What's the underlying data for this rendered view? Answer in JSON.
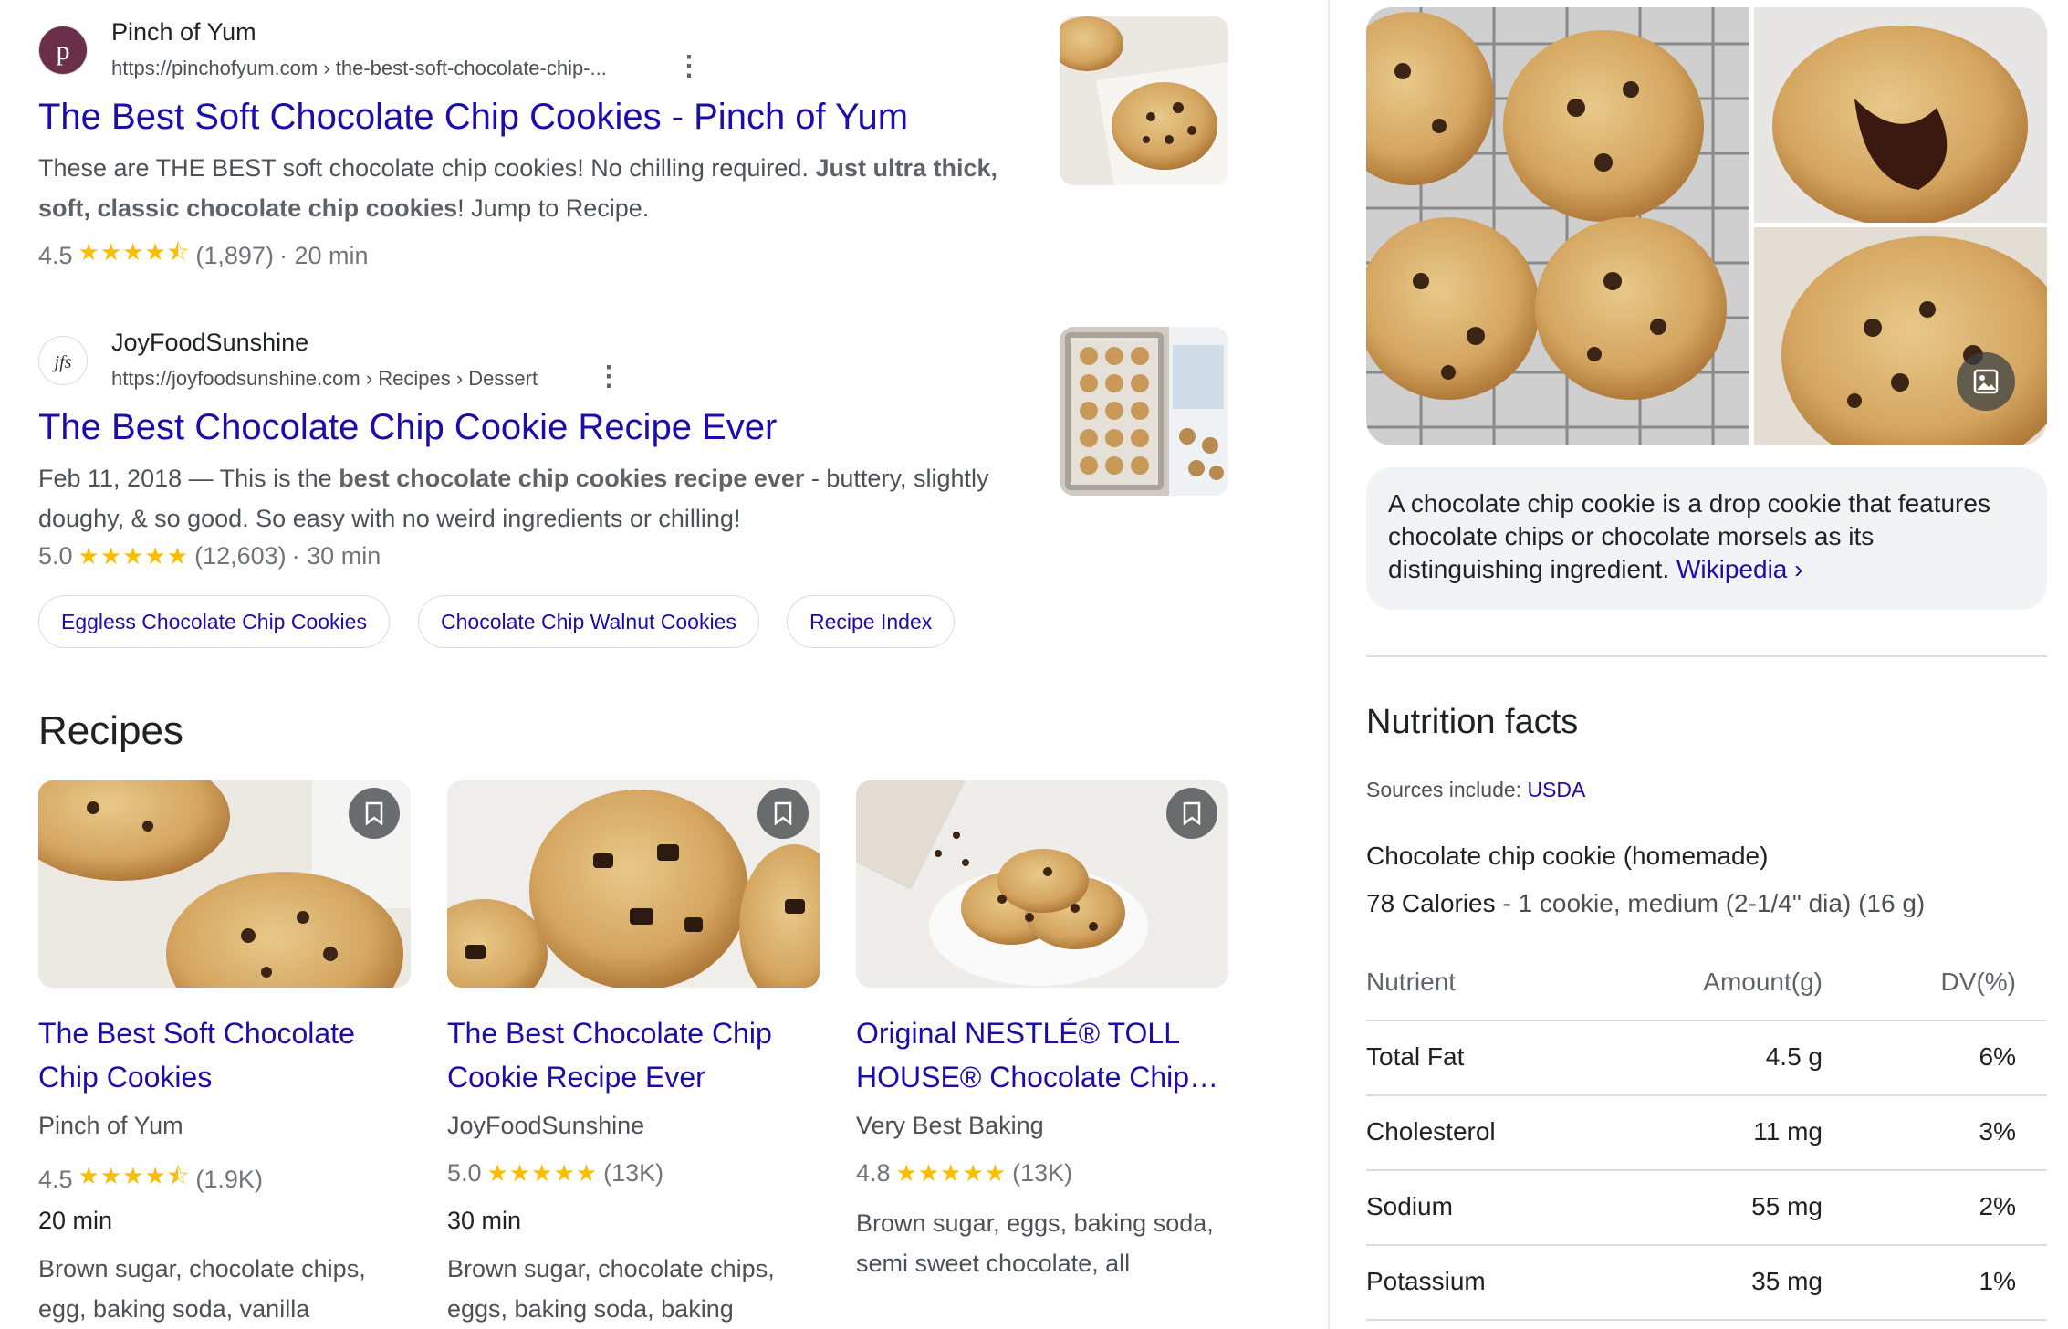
{
  "results": [
    {
      "site_name": "Pinch of Yum",
      "url": "https://pinchofyum.com › the-best-soft-chocolate-chip-...",
      "title": "The Best Soft Chocolate Chip Cookies - Pinch of Yum",
      "snippet_pre": "These are THE BEST soft chocolate chip cookies! No chilling required. ",
      "snippet_bold": "Just ultra thick, soft, classic chocolate chip cookies",
      "snippet_post": "! Jump to Recipe.",
      "rating": "4.5",
      "stars": "★★★★⯪",
      "reviews": "(1,897)",
      "time": "· 20 min"
    },
    {
      "site_name": "JoyFoodSunshine",
      "url": "https://joyfoodsunshine.com › Recipes › Dessert",
      "title": "The Best Chocolate Chip Cookie Recipe Ever",
      "snippet_pre": "Feb 11, 2018 — This is the ",
      "snippet_bold": "best chocolate chip cookies recipe ever",
      "snippet_post": " - buttery, slightly doughy, & so good. So easy with no weird ingredients or chilling!",
      "rating": "5.0",
      "stars": "★★★★★",
      "reviews": "(12,603)",
      "time": "· 30 min"
    }
  ],
  "chips": [
    "Eggless Chocolate Chip Cookies",
    "Chocolate Chip Walnut Cookies",
    "Recipe Index"
  ],
  "recipes_heading": "Recipes",
  "recipe_cards": [
    {
      "title": "The Best Soft Chocolate Chip Cookies",
      "source": "Pinch of Yum",
      "rating": "4.5",
      "stars": "★★★★⯪",
      "count": "(1.9K)",
      "time": "20 min",
      "ingredients": "Brown sugar, chocolate chips, egg, baking soda, vanilla"
    },
    {
      "title": "The Best Chocolate Chip Cookie Recipe Ever",
      "source": "JoyFoodSunshine",
      "rating": "5.0",
      "stars": "★★★★★",
      "count": "(13K)",
      "time": "30 min",
      "ingredients": "Brown sugar, chocolate chips, eggs, baking soda, baking"
    },
    {
      "title": "Original NESTLÉ® TOLL HOUSE® Chocolate Chip…",
      "source": "Very Best Baking",
      "rating": "4.8",
      "stars": "★★★★★",
      "count": "(13K)",
      "time": "",
      "ingredients": "Brown sugar, eggs, baking soda, semi sweet chocolate, all"
    }
  ],
  "knowledge_panel": {
    "description": "A chocolate chip cookie is a drop cookie that features chocolate chips or chocolate morsels as its distinguishing ingredient.",
    "wiki_link": "Wikipedia ›",
    "nutrition_title": "Nutrition facts",
    "sources_label": "Sources include:",
    "sources_link": "USDA",
    "food_name": "Chocolate chip cookie (homemade)",
    "calories": "78 Calories",
    "serving": " - 1 cookie, medium (2-1/4\" dia) (16 g)",
    "table_headers": [
      "Nutrient",
      "Amount(g)",
      "DV(%)"
    ],
    "rows": [
      {
        "nutrient": "Total Fat",
        "amount": "4.5 g",
        "dv": "6%"
      },
      {
        "nutrient": "Cholesterol",
        "amount": "11 mg",
        "dv": "3%"
      },
      {
        "nutrient": "Sodium",
        "amount": "55 mg",
        "dv": "2%"
      },
      {
        "nutrient": "Potassium",
        "amount": "35 mg",
        "dv": "1%"
      }
    ]
  },
  "colors": {
    "link": "#1a0dab",
    "star": "#fbbc04",
    "text": "#202124",
    "muted": "#4d5156"
  }
}
